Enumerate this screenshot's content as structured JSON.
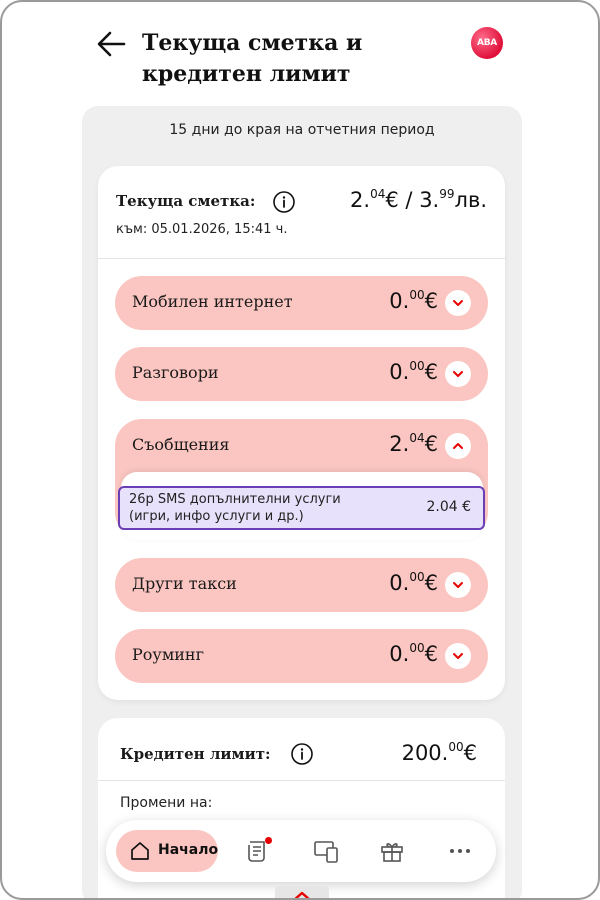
{
  "header": {
    "title_line1": "Текуща сметка и",
    "title_line2": "кредитен лимит",
    "logo_text": "АВА"
  },
  "period_note": "15 дни до края на отчетния период",
  "account": {
    "label": "Текуща сметка:",
    "amount_eur_main": "2.",
    "amount_eur_sup": "04",
    "amount_eur_unit": "€",
    "separator": "/",
    "amount_bgn_main": "3.",
    "amount_bgn_sup": "99",
    "amount_bgn_unit": "лв.",
    "as_of": "към: 05.01.2026, 15:41 ч."
  },
  "categories": [
    {
      "label": "Мобилен интернет",
      "main": "0.",
      "sup": "00",
      "unit": "€"
    },
    {
      "label": "Разговори",
      "main": "0.",
      "sup": "00",
      "unit": "€"
    },
    {
      "label": "Съобщения",
      "main": "2.",
      "sup": "04",
      "unit": "€"
    },
    {
      "label": "Други такси",
      "main": "0.",
      "sup": "00",
      "unit": "€"
    },
    {
      "label": "Роуминг",
      "main": "0.",
      "sup": "00",
      "unit": "€"
    }
  ],
  "messages_detail": {
    "line1": "26р SMS допълнителни услуги",
    "line2": "(игри, инфо услуги и др.)",
    "amount": "2.04 €"
  },
  "credit": {
    "label": "Кредитен лимит:",
    "main": "200.",
    "sup": "00",
    "unit": "€",
    "change_label": "Промени на:"
  },
  "nav": {
    "home_label": "Начало"
  },
  "colors": {
    "accent_pill": "#fbc6c1",
    "brand_red": "#e60000",
    "selection_border": "#6a3fb5",
    "selection_fill": "#e8e1fb"
  }
}
